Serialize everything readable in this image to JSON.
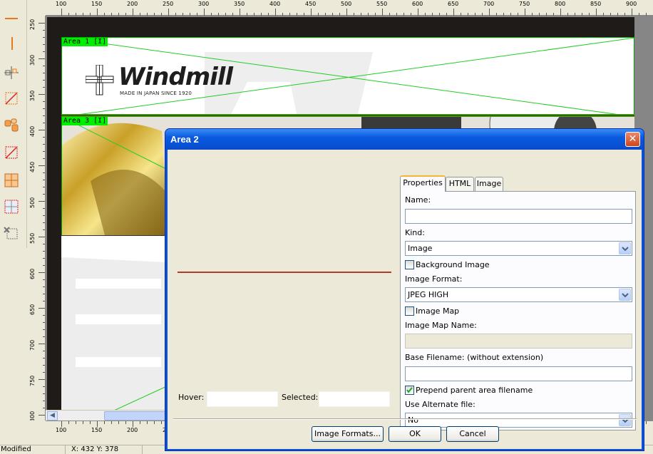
{
  "ruler": {
    "top_labels": [
      "100",
      "150",
      "200",
      "250",
      "300",
      "350",
      "400",
      "450",
      "500",
      "550",
      "600",
      "650",
      "700",
      "750",
      "800",
      "850",
      "900"
    ],
    "left_labels": [
      "250",
      "300",
      "350",
      "400",
      "450",
      "500",
      "550",
      "600",
      "650",
      "700",
      "750",
      "800"
    ]
  },
  "canvas": {
    "area1_label": "Area 1 [I]",
    "area3_label": "Area 3 [I]",
    "logo_text": "Windmill",
    "logo_tagline": "MADE IN JAPAN SINCE 1920"
  },
  "statusbar": {
    "state": "Modified",
    "coords": "X: 432 Y: 378"
  },
  "dialog": {
    "title": "Area 2",
    "close_symbol": "✕",
    "hover_label": "Hover:",
    "selected_label": "Selected:",
    "tabs": [
      {
        "label": "Properties",
        "active": true
      },
      {
        "label": "HTML",
        "active": false
      },
      {
        "label": "Image",
        "active": false
      }
    ],
    "properties": {
      "name_label": "Name:",
      "name_value": "",
      "kind_label": "Kind:",
      "kind_value": "Image",
      "background_image_label": "Background Image",
      "background_image_checked": false,
      "image_format_label": "Image Format:",
      "image_format_value": "JPEG HIGH",
      "image_map_label": "Image Map",
      "image_map_checked": false,
      "image_map_name_label": "Image Map Name:",
      "image_map_name_value": "",
      "base_filename_label": "Base Filename: (without extension)",
      "base_filename_value": "",
      "prepend_label": "Prepend parent area filename",
      "prepend_checked": true,
      "alternate_label": "Use Alternate file:",
      "alternate_value": "No"
    },
    "buttons": {
      "image_formats": "Image Formats...",
      "ok": "OK",
      "cancel": "Cancel"
    }
  },
  "colors": {
    "accent_title": "#0a5ae0",
    "area_outline": "#00ee00",
    "slice_line": "#b23a2a"
  }
}
